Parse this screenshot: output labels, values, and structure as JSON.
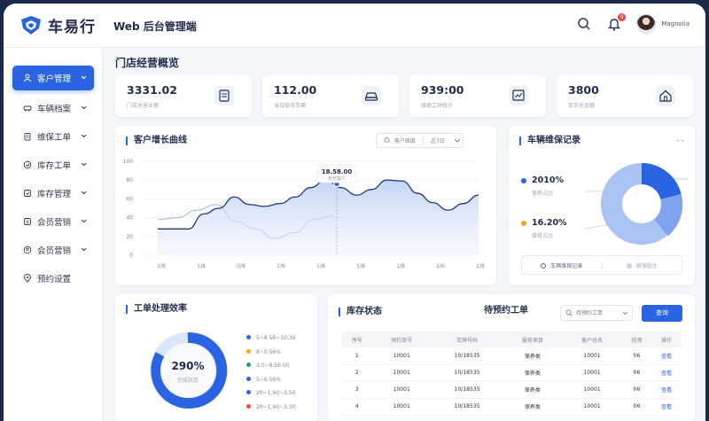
{
  "header": {
    "logo_text": "车易行",
    "system_title": "Web 后台管理端",
    "user_name": "Magnolia",
    "notification_count": "9"
  },
  "sidebar": {
    "items": [
      {
        "label": "客户管理",
        "icon": "user-icon",
        "active": true
      },
      {
        "label": "车辆档案",
        "icon": "car-icon"
      },
      {
        "label": "维保工单",
        "icon": "clipboard-icon"
      },
      {
        "label": "库存工单",
        "icon": "box-icon"
      },
      {
        "label": "库存管理",
        "icon": "settings-icon"
      },
      {
        "label": "会员营销",
        "icon": "member-icon"
      },
      {
        "label": "会员营销",
        "icon": "member-icon"
      },
      {
        "label": "预约设置",
        "icon": "location-icon"
      }
    ]
  },
  "page_title": "门店经营概览",
  "kpis": [
    {
      "value": "3331.02",
      "sub": "门店总营业额",
      "icon": "document-icon"
    },
    {
      "value": "112.00",
      "sub": "当日接待车辆",
      "icon": "car-icon"
    },
    {
      "value": "939:00",
      "sub": "维修工时统计",
      "icon": "chart-icon"
    },
    {
      "value": "3800",
      "sub": "库存总金额",
      "icon": "home-icon"
    }
  ],
  "customer_growth": {
    "title": "客户增长曲线",
    "filter_primary": "客户维度",
    "filter_secondary": "近7日",
    "tooltip_value": "18.58.00",
    "tooltip_label": "新增客户"
  },
  "maintenance": {
    "title": "车辆维保记录",
    "more": "• •",
    "stat1_value": "2010%",
    "stat1_label": "保养占比",
    "stat2_value": "16.20%",
    "stat2_label": "维修占比",
    "tab1": "车辆维保记录",
    "tab2": "维保统计"
  },
  "efficiency": {
    "title": "工单处理效率",
    "center_value": "290%",
    "center_label": "完成状态",
    "legend": [
      {
        "label": "5~8.56~10:36",
        "color": "#2b64e3"
      },
      {
        "label": "8~0.56%",
        "color": "#f5a623"
      },
      {
        "label": "3.0~8.56.00",
        "color": "#22a06b"
      },
      {
        "label": "5~6.56%",
        "color": "#2b64e3"
      },
      {
        "label": "20~1.90~3.50",
        "color": "#2b64e3"
      },
      {
        "label": "20~1.90~3.30",
        "color": "#e5533d"
      }
    ]
  },
  "inventory": {
    "title": "库存状态",
    "pending_title": "待预约工单",
    "search_placeholder": "待预约工单",
    "search_button": "查询",
    "columns": [
      "序号",
      "预约单号",
      "车牌号码",
      "服务项目",
      "客户姓名",
      "技师",
      "操作"
    ],
    "rows": [
      {
        "no": "1",
        "order": "10001",
        "plate": "10/18535",
        "service": "保养类",
        "customer": "10001",
        "tech": "06",
        "action": "查看"
      },
      {
        "no": "2",
        "order": "10001",
        "plate": "10/18535",
        "service": "保养类",
        "customer": "10001",
        "tech": "06",
        "action": "查看"
      },
      {
        "no": "3",
        "order": "10001",
        "plate": "10/18535",
        "service": "保养类",
        "customer": "10001",
        "tech": "06",
        "action": "查看"
      },
      {
        "no": "4",
        "order": "10001",
        "plate": "10/18535",
        "service": "保养类",
        "customer": "10001",
        "tech": "06",
        "action": "查看"
      }
    ]
  },
  "chart_data": {
    "type": "area",
    "title": "客户增长曲线",
    "x": [
      "1/8",
      "1/8",
      "0/8",
      "1/6",
      "1/8",
      "1/8",
      "1/8",
      "1/6",
      "1/8"
    ],
    "y_ticks": [
      "100",
      "80",
      "60",
      "40",
      "20",
      "0"
    ],
    "ylim": [
      0,
      100
    ],
    "series": [
      {
        "values": [
          28,
          28,
          28,
          44,
          50,
          62,
          54,
          52,
          55,
          62,
          72,
          80,
          72,
          64,
          70,
          80,
          79,
          66,
          56,
          48,
          55,
          64
        ]
      },
      {
        "values": [
          38,
          40,
          48,
          54,
          36,
          28,
          18,
          24,
          38,
          42
        ]
      }
    ],
    "grid": true
  }
}
